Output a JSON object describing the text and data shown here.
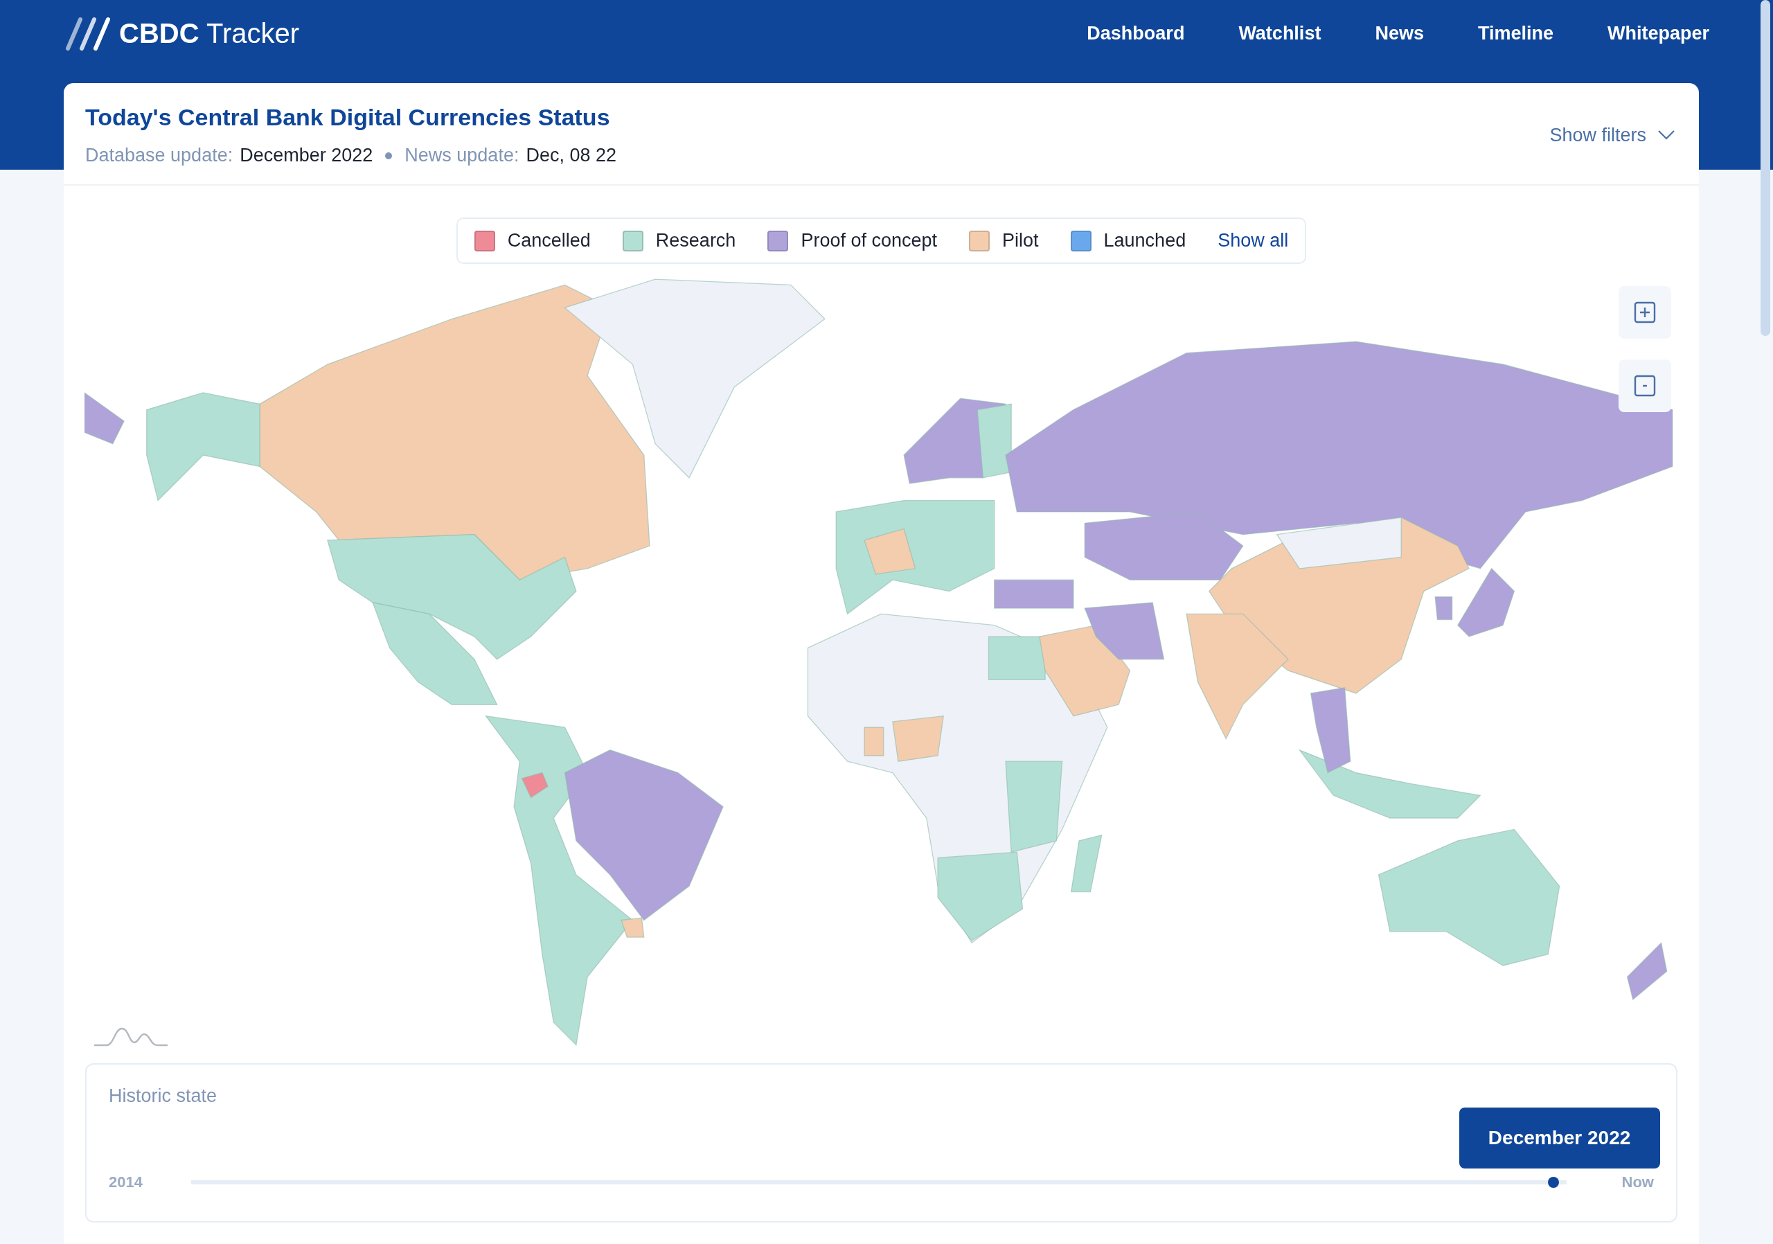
{
  "brand": {
    "logo": "**CBDC** Tracker"
  },
  "nav": [
    {
      "label": "Dashboard"
    },
    {
      "label": "Watchlist"
    },
    {
      "label": "News"
    },
    {
      "label": "Timeline"
    },
    {
      "label": "Whitepaper"
    }
  ],
  "header": {
    "title": "Today's Central Bank Digital Currencies Status",
    "database_label": "Database update:",
    "database_value": "December 2022",
    "news_label": "News update:",
    "news_value": "Dec, 08 22",
    "filters": "Show filters"
  },
  "legend": [
    {
      "label": "Cancelled",
      "color": "#ef8a97"
    },
    {
      "label": "Research",
      "color": "#b3e0d4"
    },
    {
      "label": "Proof of concept",
      "color": "#b0a3da"
    },
    {
      "label": "Pilot",
      "color": "#f3cdae"
    },
    {
      "label": "Launched",
      "color": "#6aa8ee"
    }
  ],
  "show_all": "Show all",
  "historic": {
    "title": "Historic state",
    "start": "2014",
    "end": "Now",
    "tooltip": "December 2022",
    "level": 0.995
  }
}
